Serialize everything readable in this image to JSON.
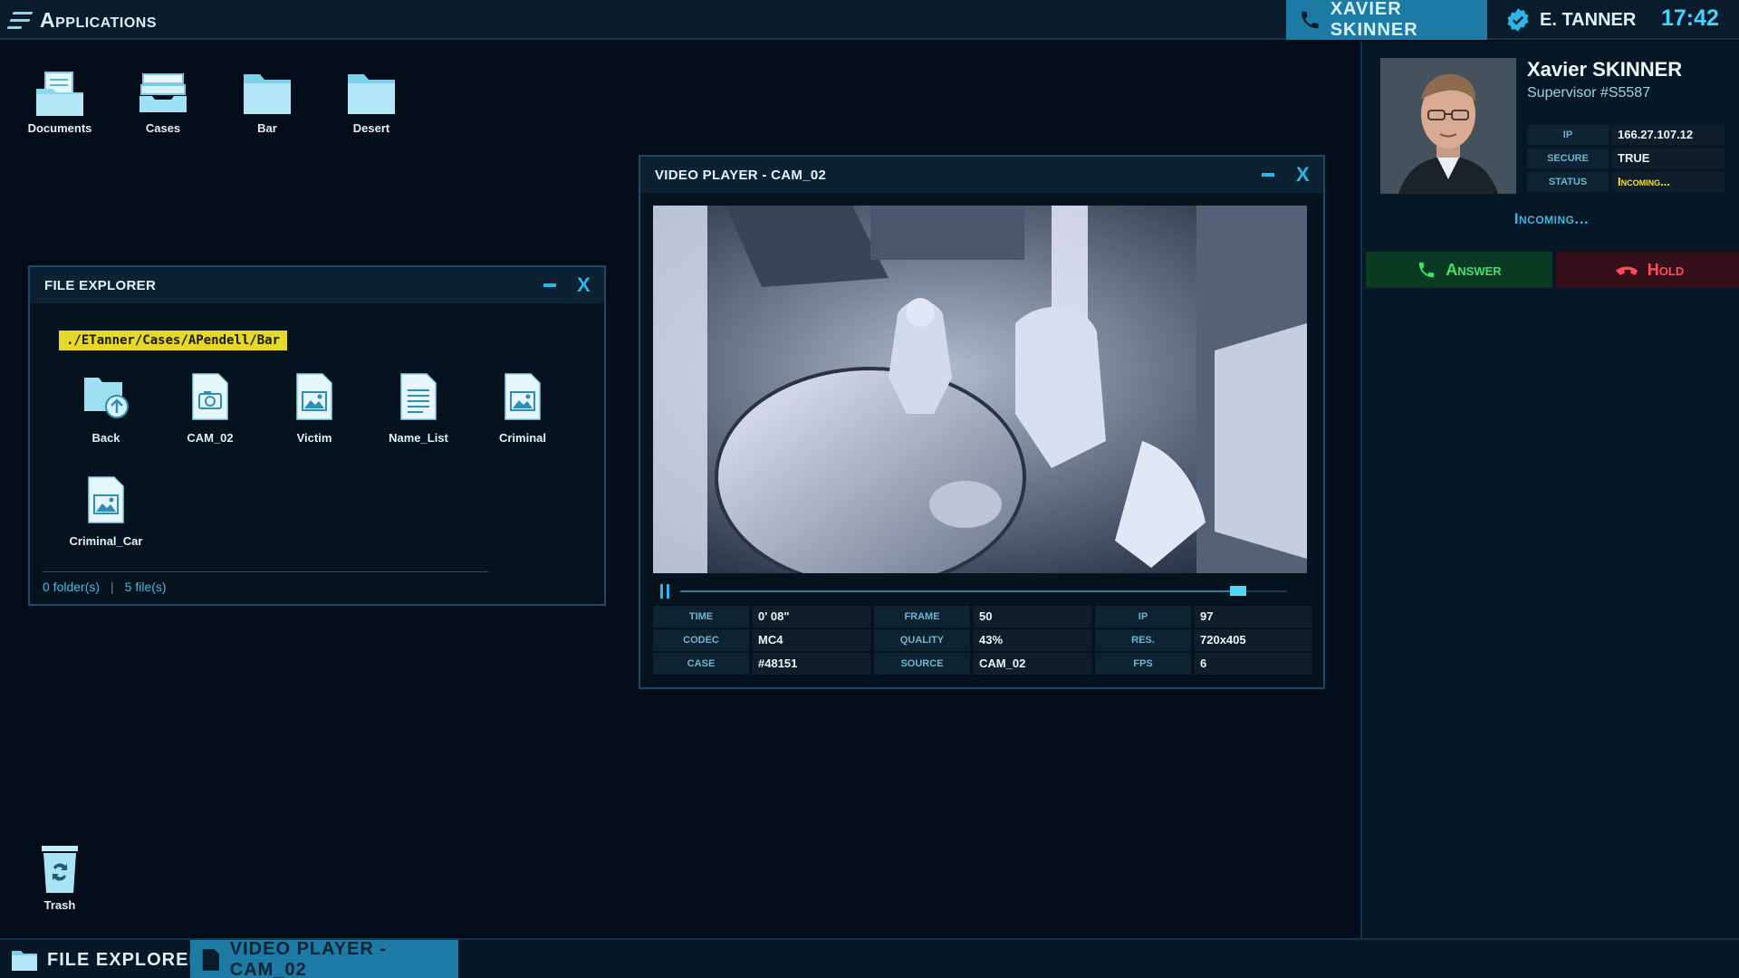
{
  "topbar": {
    "apps_title": "Applications",
    "call_contact": "XAVIER SKINNER",
    "user_name": "E. TANNER",
    "clock": "17:42"
  },
  "desktop": {
    "icons": [
      {
        "label": "Documents",
        "icon": "documents-folder-icon"
      },
      {
        "label": "Cases",
        "icon": "cases-drawer-icon"
      },
      {
        "label": "Bar",
        "icon": "folder-icon"
      },
      {
        "label": "Desert",
        "icon": "folder-icon"
      }
    ],
    "trash_label": "Trash"
  },
  "file_explorer": {
    "title": "FILE EXPLORER",
    "path": "./ETanner/Cases/APendell/Bar",
    "items": [
      {
        "label": "Back",
        "icon": "folder-back-icon"
      },
      {
        "label": "CAM_02",
        "icon": "camera-file-icon"
      },
      {
        "label": "Victim",
        "icon": "image-file-icon"
      },
      {
        "label": "Name_List",
        "icon": "text-file-icon"
      },
      {
        "label": "Criminal",
        "icon": "image-file-icon"
      },
      {
        "label": "Criminal_Car",
        "icon": "image-file-icon"
      }
    ],
    "folders_count": "0 folder(s)",
    "separator": "|",
    "files_count": "5 file(s)"
  },
  "video_player": {
    "title": "VIDEO PLAYER - CAM_02",
    "progress": 0.92,
    "meta": [
      {
        "key": "TIME",
        "value": "0' 08\""
      },
      {
        "key": "FRAME",
        "value": "50"
      },
      {
        "key": "IP",
        "value": "97"
      },
      {
        "key": "CODEC",
        "value": "MC4"
      },
      {
        "key": "QUALITY",
        "value": "43%"
      },
      {
        "key": "RES.",
        "value": "720x405"
      },
      {
        "key": "CASE",
        "value": "#48151"
      },
      {
        "key": "SOURCE",
        "value": "CAM_02"
      },
      {
        "key": "FPS",
        "value": "6"
      }
    ]
  },
  "caller": {
    "name": "Xavier SKINNER",
    "role": "Supervisor #S5587",
    "ip_key": "IP",
    "ip": "166.27.107.12",
    "secure_key": "SECURE",
    "secure": "TRUE",
    "status_key": "STATUS",
    "status": "Incoming...",
    "incoming_text": "Incoming...",
    "answer_label": "Answer",
    "hold_label": "Hold"
  },
  "taskbar": {
    "items": [
      {
        "label": "FILE EXPLORER",
        "active": false
      },
      {
        "label": "VIDEO PLAYER - CAM_02",
        "active": true
      }
    ]
  },
  "colors": {
    "accent": "#2ab6e8",
    "path_chip": "#e6d82a",
    "answer": "#3fe06a",
    "hold": "#ff4c5a",
    "status_warn": "#f0e23a"
  }
}
